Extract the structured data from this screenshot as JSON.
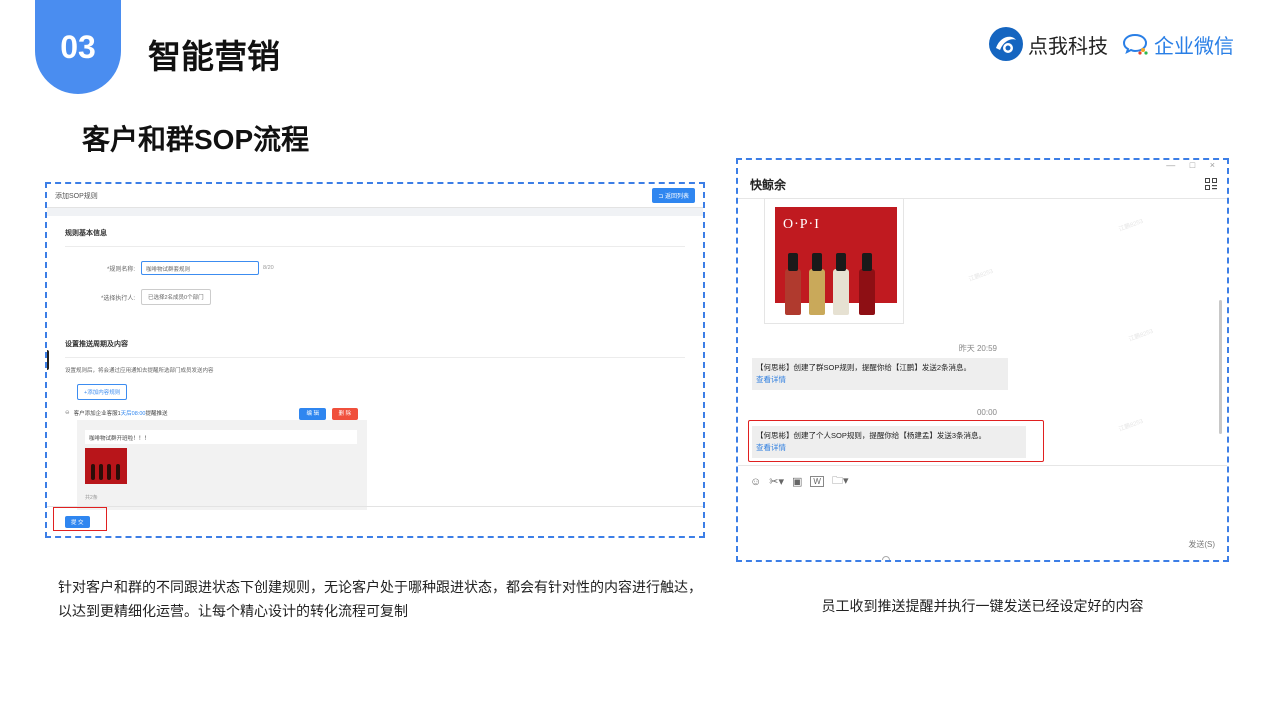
{
  "header": {
    "section_number": "03",
    "title": "智能营销",
    "subtitle": "客户和群SOP流程"
  },
  "logos": [
    {
      "name": "点我科技",
      "icon": "dianwo-logo-icon",
      "color": "#1565c0"
    },
    {
      "name": "企业微信",
      "icon": "wecom-logo-icon",
      "color": "#2a7fe6"
    }
  ],
  "left_screenshot": {
    "page_title": "添加SOP规则",
    "back_button": "返回列表",
    "section_basic": "规则基本信息",
    "rule_name_label": "*规则名称:",
    "rule_name_value": "咖啡物试群套规则",
    "rule_name_count": "8/20",
    "executor_label": "*选择执行人:",
    "executor_value": "已选择2名成员0个部门",
    "section_push": "设置推送周期及内容",
    "push_desc": "设置规则后，将会通过应用通知去提醒所选部门成员发送内容",
    "add_rule_button": "+添加内容规则",
    "rule_text_prefix": "客户添加企业客服1",
    "rule_text_highlight": "天后08:00",
    "rule_text_suffix": "提醒推送",
    "edit_button": "编 辑",
    "delete_button": "删 除",
    "message_text": "咖啡物试群开班啦！！！",
    "total_text": "共2条",
    "submit_button": "提 交"
  },
  "right_screenshot": {
    "window_controls": "— □ ×",
    "chat_title": "快鲸余",
    "product_brand": "O·P·I",
    "time1": "昨天 20:59",
    "message1": "【何思彬】创建了群SOP规则，提醒你给【江鹏】发送2条消息。",
    "message1_link": "查看详情",
    "time2": "00:00",
    "message2": "【何思彬】创建了个人SOP规则，提醒你给【杨建孟】发送3条消息。",
    "message2_link": "查看详情",
    "tools": [
      "smile-icon",
      "scissors-icon",
      "image-icon",
      "word-icon",
      "folder-icon"
    ],
    "send_button": "发送(S)",
    "watermark": "江鹏8253"
  },
  "captions": {
    "left": "针对客户和群的不同跟进状态下创建规则，无论客户处于哪种跟进状态，都会有针对性的内容进行触达，以达到更精细化运营。让每个精心设计的转化流程可复制",
    "right": "员工收到推送提醒并执行一键发送已经设定好的内容"
  },
  "colors": {
    "accent_blue": "#4a8df0",
    "highlight_red": "#e02020",
    "frame_dash": "#3c7ee6"
  }
}
